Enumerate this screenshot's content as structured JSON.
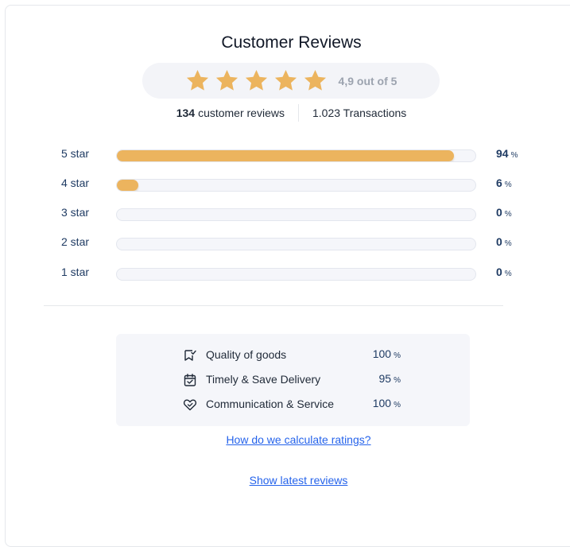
{
  "header": {
    "title": "Customer Reviews"
  },
  "summary": {
    "stars_filled": 5,
    "average_text": "4,9 out of 5",
    "review_count": "134",
    "review_label": "customer reviews",
    "transactions": "1.023 Transactions",
    "star_color": "#ECB45E"
  },
  "distribution": [
    {
      "label": "5 star",
      "percent": 94,
      "percent_text": "94",
      "unit": "%"
    },
    {
      "label": "4 star",
      "percent": 6,
      "percent_text": "6",
      "unit": "%"
    },
    {
      "label": "3 star",
      "percent": 0,
      "percent_text": "0",
      "unit": "%"
    },
    {
      "label": "2 star",
      "percent": 0,
      "percent_text": "0",
      "unit": "%"
    },
    {
      "label": "1 star",
      "percent": 0,
      "percent_text": "0",
      "unit": "%"
    }
  ],
  "metrics": [
    {
      "icon": "quality-icon",
      "label": "Quality of goods",
      "value": "100",
      "unit": "%"
    },
    {
      "icon": "calendar-check-icon",
      "label": "Timely & Save Delivery",
      "value": "95",
      "unit": "%"
    },
    {
      "icon": "heart-icon",
      "label": "Communication & Service",
      "value": "100",
      "unit": "%"
    }
  ],
  "links": {
    "calculate": "How do we calculate ratings?",
    "latest": "Show latest reviews"
  }
}
